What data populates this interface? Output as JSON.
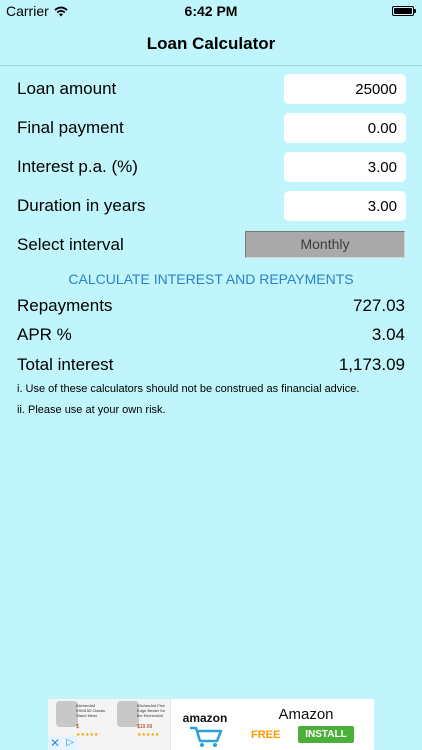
{
  "status_bar": {
    "carrier": "Carrier",
    "time": "6:42 PM"
  },
  "nav": {
    "title": "Loan Calculator"
  },
  "inputs": [
    {
      "label": "Loan amount",
      "value": "25000"
    },
    {
      "label": "Final payment",
      "value": "0.00"
    },
    {
      "label": "Interest p.a. (%)",
      "value": "3.00"
    },
    {
      "label": "Duration in years",
      "value": "3.00"
    }
  ],
  "interval": {
    "label": "Select interval",
    "value": "Monthly"
  },
  "calculate_label": "CALCULATE INTEREST AND REPAYMENTS",
  "results": [
    {
      "label": "Repayments",
      "value": "727.03"
    },
    {
      "label": "APR %",
      "value": "3.04"
    },
    {
      "label": "Total interest",
      "value": "1,173.09"
    }
  ],
  "disclaimers": [
    "i. Use of these calculators should not be construed as financial advice.",
    "ii. Please use at your own risk."
  ],
  "ad": {
    "products": [
      {
        "title": "KitchenAid KSM150 Classic Stand Mixer",
        "price": "$",
        "stars": "★★★★★"
      },
      {
        "title": "KitchenAid Flex Edge Beater for the KitchenAid",
        "price": "$19.99",
        "stars": "★★★★★"
      }
    ],
    "logo": "amazon",
    "app_name": "Amazon",
    "free_label": "FREE",
    "install_label": "INSTALL",
    "close_symbol": "✕",
    "choices_symbol": "▷",
    "colors": {
      "free": "#ff9900",
      "install": "#4caf3a",
      "cart": "#2a9fd8"
    }
  },
  "colors": {
    "background": "#bff5fb",
    "accent": "#2a83c8",
    "selector": "#a9a9a9"
  }
}
